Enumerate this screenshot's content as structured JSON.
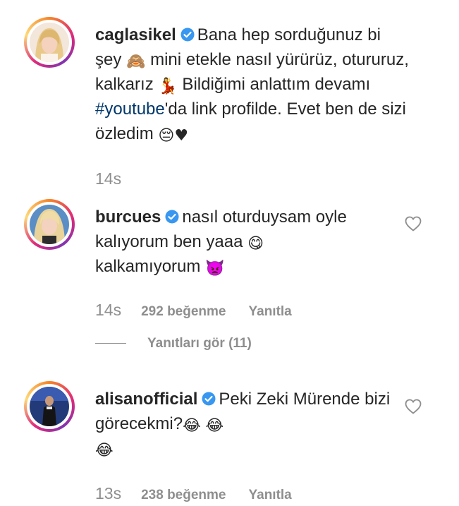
{
  "comments": [
    {
      "username": "caglasikel",
      "verified": true,
      "text_parts": [
        "Bana hep sorduğunuz bi şey ",
        " mini etekle nasıl yürürüz, otururuz, kalkarız ",
        " Bildiğimi anlattım devamı ",
        "#youtube",
        "'da link profilde. Evet ben de sizi özledim "
      ],
      "emojis": [
        "🙈",
        "💃",
        "😔",
        "♥"
      ],
      "time": "14s",
      "likes": "",
      "reply_label": "",
      "avatar_icon": "blonde-woman-avatar"
    },
    {
      "username": "burcues",
      "verified": true,
      "text_parts": [
        "nasıl oturduysam oyle kalıyorum ben yaaa ",
        " kalkamıyorum "
      ],
      "emojis": [
        "😋",
        "👿"
      ],
      "time": "14s",
      "likes": "292 beğenme",
      "reply_label": "Yanıtla",
      "view_replies": "Yanıtları gör (11)",
      "avatar_icon": "blonde-woman-avatar"
    },
    {
      "username": "alisanofficial",
      "verified": true,
      "text_parts": [
        "Peki Zeki Mürende bizi görecekmi?"
      ],
      "emojis": [
        "😂",
        "😂",
        "😂"
      ],
      "time": "13s",
      "likes": "238 beğenme",
      "reply_label": "Yanıtla",
      "avatar_icon": "man-on-stage-avatar"
    }
  ],
  "colors": {
    "text": "#262626",
    "muted": "#8e8e8e",
    "hashtag": "#00376b",
    "verified": "#3897f0"
  }
}
